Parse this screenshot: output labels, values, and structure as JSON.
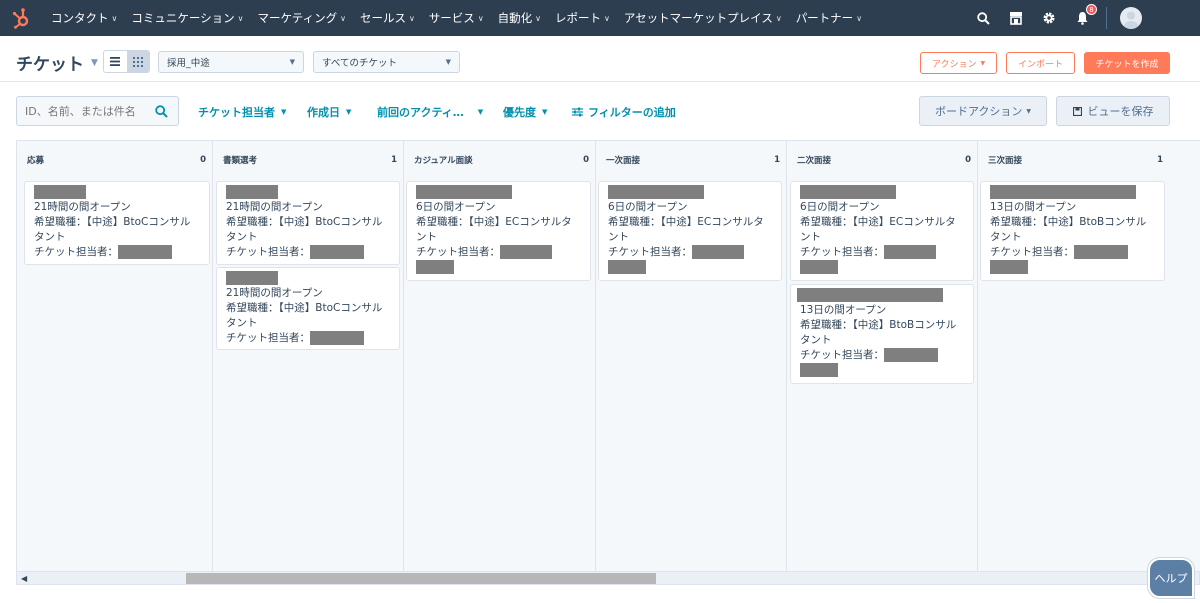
{
  "nav": {
    "items": [
      {
        "label": "コンタクト"
      },
      {
        "label": "コミュニケーション"
      },
      {
        "label": "マーケティング"
      },
      {
        "label": "セールス"
      },
      {
        "label": "サービス"
      },
      {
        "label": "自動化"
      },
      {
        "label": "レポート"
      },
      {
        "label": "アセットマーケットプレイス"
      },
      {
        "label": "パートナー"
      }
    ],
    "notification_count": "8"
  },
  "header": {
    "title": "チケット",
    "pipeline_select": "採用_中途",
    "view_select": "すべてのチケット",
    "actions_button": "アクション",
    "import_button": "インポート",
    "create_button": "チケットを作成"
  },
  "filters": {
    "search_placeholder": "ID、名前、または件名",
    "owner": "チケット担当者",
    "created": "作成日",
    "last_activity": "前回のアクティ…",
    "priority": "優先度",
    "add_filter": "フィルターの追加",
    "board_actions": "ボードアクション",
    "save_view": "ビューを保存"
  },
  "columns": [
    {
      "name": "応募",
      "count": "0",
      "cards": [
        {
          "line1": "21時間の間オープン",
          "line2": "希望職種：【中途】BtoCコンサル",
          "line3": "タント",
          "owner_label": "チケット担当者："
        }
      ]
    },
    {
      "name": "書類選考",
      "count": "1",
      "cards": [
        {
          "line1": "21時間の間オープン",
          "line2": "希望職種：【中途】BtoCコンサル",
          "line3": "タント",
          "owner_label": "チケット担当者："
        },
        {
          "line1": "21時間の間オープン",
          "line2": "希望職種：【中途】BtoCコンサル",
          "line3": "タント",
          "owner_label": "チケット担当者："
        }
      ]
    },
    {
      "name": "カジュアル面談",
      "count": "0",
      "cards": [
        {
          "line1": "6日の間オープン",
          "line2": "希望職種：【中途】ECコンサルタ",
          "line3": "ント",
          "owner_label": "チケット担当者："
        }
      ]
    },
    {
      "name": "一次面接",
      "count": "1",
      "cards": [
        {
          "line1": "6日の間オープン",
          "line2": "希望職種：【中途】ECコンサルタ",
          "line3": "ント",
          "owner_label": "チケット担当者："
        }
      ]
    },
    {
      "name": "二次面接",
      "count": "0",
      "cards": [
        {
          "line1": "6日の間オープン",
          "line2": "希望職種：【中途】ECコンサルタ",
          "line3": "ント",
          "owner_label": "チケット担当者："
        },
        {
          "line1": "13日の間オープン",
          "line2": "希望職種：【中途】BtoBコンサル",
          "line3": "タント",
          "owner_label": "チケット担当者："
        }
      ]
    },
    {
      "name": "三次面接",
      "count": "1",
      "cards": [
        {
          "line1": "13日の間オープン",
          "line2": "希望職種：【中途】BtoBコンサル",
          "line3": "タント",
          "owner_label": "チケット担当者："
        }
      ]
    }
  ],
  "help_button": "ヘルプ",
  "colors": {
    "nav_bg": "#2d3e50",
    "accent": "#ff7a59",
    "link": "#0091ae"
  }
}
